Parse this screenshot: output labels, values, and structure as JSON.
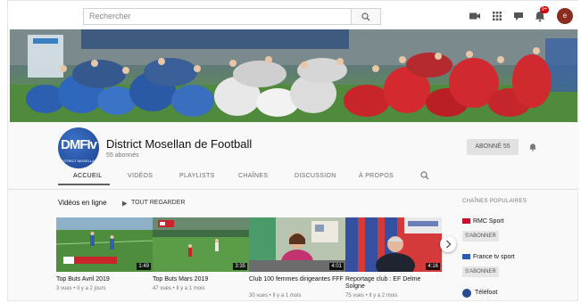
{
  "topbar": {
    "search_placeholder": "Rechercher",
    "notification_count": "9+",
    "account_initial": "e"
  },
  "channel": {
    "logo_text": "DMFIv",
    "logo_subtext": "DISTRICT MOSELLAN",
    "title": "District Mosellan de Football",
    "subscribers": "55 abonnés",
    "subscribe_label": "ABONNÉ 55"
  },
  "tabs": [
    {
      "label": "ACCUEIL",
      "active": true
    },
    {
      "label": "VIDÉOS",
      "active": false
    },
    {
      "label": "PLAYLISTS",
      "active": false
    },
    {
      "label": "CHAÎNES",
      "active": false
    },
    {
      "label": "DISCUSSION",
      "active": false
    },
    {
      "label": "À PROPOS",
      "active": false
    }
  ],
  "section": {
    "title": "Vidéos en ligne",
    "play_all": "TOUT REGARDER"
  },
  "videos": [
    {
      "title": "Top Buts Avril 2019",
      "meta": "3 vues • Il y a 2 jours",
      "duration": "1:49"
    },
    {
      "title": "Top Buts Mars 2019",
      "meta": "47 vues • Il y a 1 mois",
      "duration": "3:35"
    },
    {
      "title": "Club 100 femmes dirigeantes FFF",
      "meta": "30 vues • Il y a 1 mois",
      "duration": "4:01"
    },
    {
      "title": "Reportage club : EF Delme Solgne",
      "meta": "75 vues • Il y a 2 mois",
      "duration": "4:16"
    }
  ],
  "sidebar": {
    "title": "CHAÎNES POPULAIRES",
    "channels": [
      {
        "name": "RMC Sport",
        "action": "S'ABONNER",
        "color": "#c8102e"
      },
      {
        "name": "France tv sport",
        "action": "S'ABONNER",
        "color": "#2b5bb5"
      },
      {
        "name": "Téléfoot",
        "action": "",
        "color": "#2a4b8d"
      }
    ]
  }
}
